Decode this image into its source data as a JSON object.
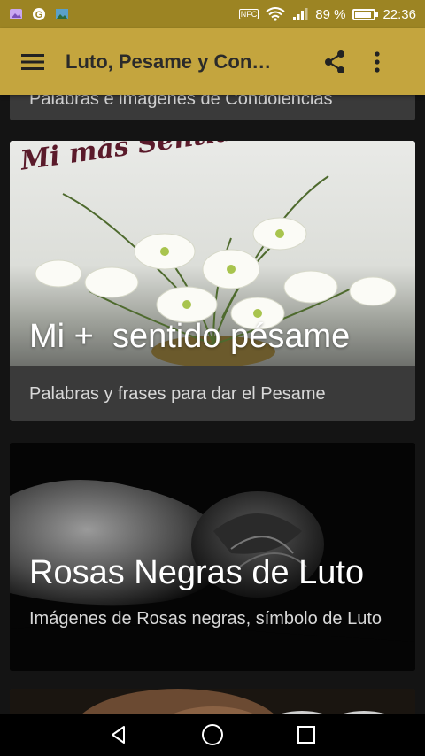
{
  "status_bar": {
    "nfc": "NFC",
    "battery_percent": "89 %",
    "battery_level": 0.89,
    "time": "22:36",
    "icons": [
      "gallery-icon",
      "google-icon",
      "image-icon",
      "nfc-icon",
      "wifi-icon",
      "signal-icon",
      "battery-icon"
    ]
  },
  "app_bar": {
    "title": "Luto, Pesame y Con…",
    "icons": [
      "menu-icon",
      "share-icon",
      "more-vert-icon"
    ],
    "color": "#c4a53e"
  },
  "cards": [
    {
      "description": "Palabras e imágenes de Condolencias"
    },
    {
      "image_caption": "Mi más Sentido Pésame...",
      "title": "Mi +  sentido pésame",
      "description": "Palabras y frases para dar el Pesame"
    },
    {
      "title": "Rosas Negras de Luto",
      "description": "Imágenes de Rosas negras, símbolo de Luto"
    },
    {}
  ],
  "nav_bar": {
    "icons": [
      "back-icon",
      "home-icon",
      "recents-icon"
    ]
  }
}
